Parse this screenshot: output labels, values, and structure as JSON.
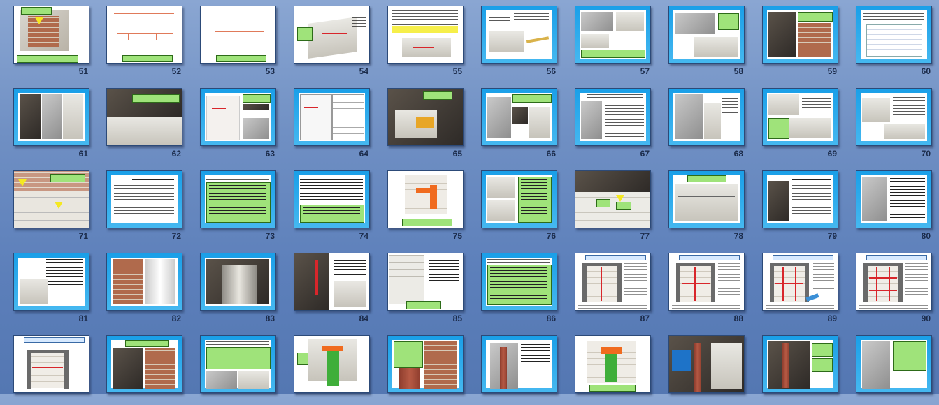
{
  "slide_numbers": [
    [
      "51",
      "52",
      "53",
      "54",
      "55",
      "56",
      "57",
      "58",
      "59",
      "60"
    ],
    [
      "61",
      "62",
      "63",
      "64",
      "65",
      "66",
      "67",
      "68",
      "69",
      "70"
    ],
    [
      "71",
      "72",
      "73",
      "74",
      "75",
      "76",
      "77",
      "78",
      "79",
      "80"
    ],
    [
      "81",
      "82",
      "83",
      "84",
      "85",
      "86",
      "87",
      "88",
      "89",
      "90"
    ],
    [
      "",
      "",
      "",
      "",
      "",
      "",
      "",
      "",
      "",
      ""
    ]
  ],
  "colors": {
    "background": "#6f8fc3",
    "slide_frame": "#1a9fe8",
    "callout": "#9fe37a",
    "highlight": "#f6ef4a",
    "accent_red": "#d8262b"
  }
}
